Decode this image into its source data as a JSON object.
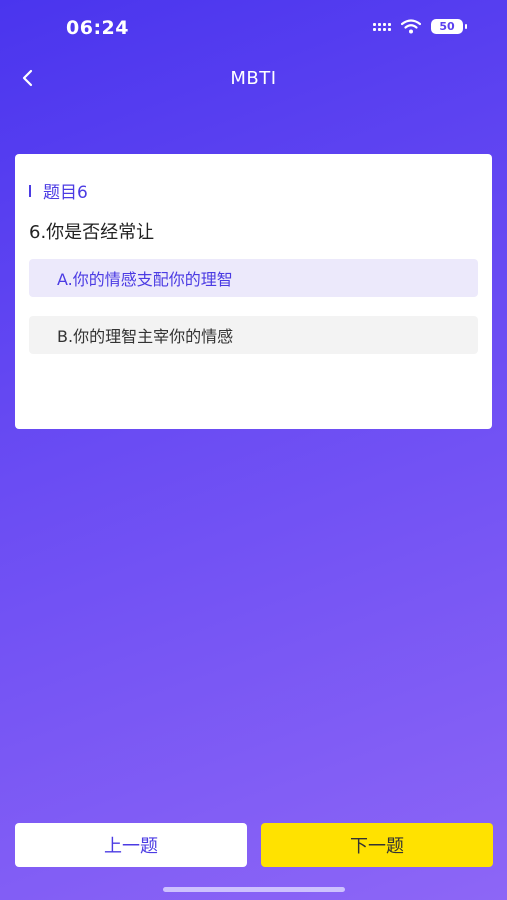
{
  "status_bar": {
    "time": "06:24",
    "battery": "50"
  },
  "nav": {
    "title": "MBTI",
    "back_icon": "chevron-left-icon"
  },
  "question": {
    "label": "题目6",
    "text": "6.你是否经常让",
    "options": [
      {
        "label": "A.你的情感支配你的理智",
        "selected": true
      },
      {
        "label": "B.你的理智主宰你的情感",
        "selected": false
      }
    ]
  },
  "footer": {
    "prev_label": "上一题",
    "next_label": "下一题"
  },
  "colors": {
    "accent": "#4b3be3",
    "primary_button": "#ffe200",
    "selected_option_bg": "#ece9fb"
  }
}
